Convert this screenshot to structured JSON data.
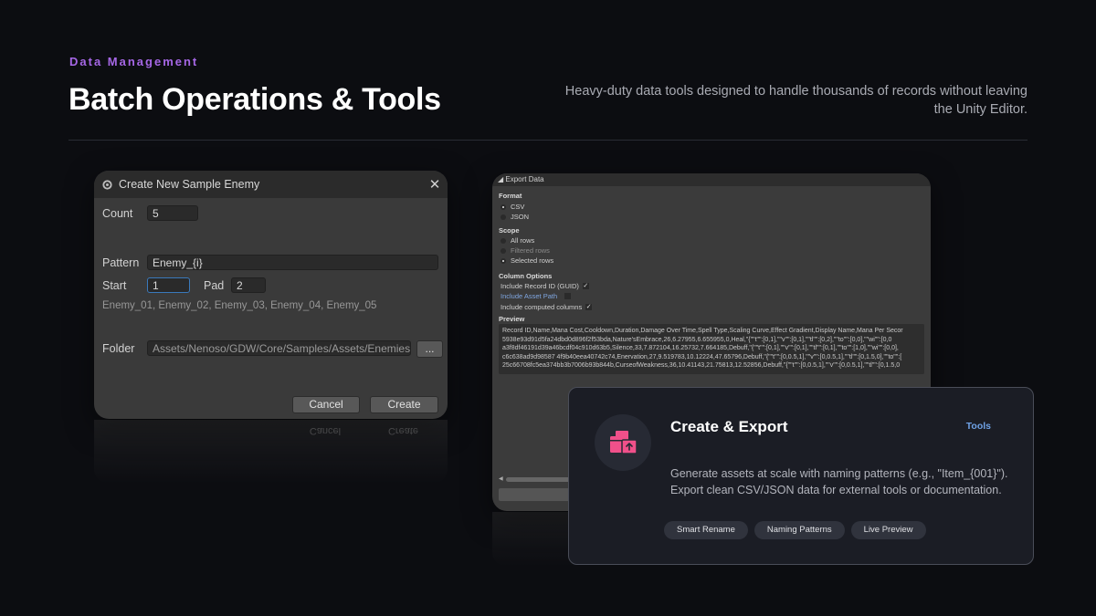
{
  "header": {
    "eyebrow": "Data Management",
    "title": "Batch Operations & Tools",
    "subtitle": "Heavy-duty data tools designed to handle thousands of records without leaving the Unity Editor."
  },
  "create_dialog": {
    "title": "Create New Sample Enemy",
    "count_label": "Count",
    "count_value": "5",
    "pattern_label": "Pattern",
    "pattern_value": "Enemy_{i}",
    "start_label": "Start",
    "start_value": "1",
    "pad_label": "Pad",
    "pad_value": "2",
    "preview_names": "Enemy_01, Enemy_02, Enemy_03, Enemy_04, Enemy_05",
    "folder_label": "Folder",
    "folder_value": "Assets/Nenoso/GDW/Core/Samples/Assets/Enemies",
    "browse_label": "...",
    "cancel_label": "Cancel",
    "create_label": "Create"
  },
  "export_panel": {
    "title": "Export Data",
    "format_label": "Format",
    "format_options": [
      "CSV",
      "JSON"
    ],
    "scope_label": "Scope",
    "scope_options": [
      "All rows",
      "Filtered rows",
      "Selected rows"
    ],
    "column_options_label": "Column Options",
    "column_options": [
      "Include Record ID (GUID)",
      "Include Asset Path",
      "Include computed columns"
    ],
    "preview_label": "Preview",
    "preview_lines": [
      "Record ID,Name,Mana Cost,Cooldown,Duration,Damage Over Time,Spell Type,Scaling Curve,Effect Gradient,Display Name,Mana Per Secor",
      "5938e93d91d5fa24dbd0d896f2f53bda,Nature'sEmbrace,26,6.27955,6.655955,0,Heal,\"{\"\"t\"\":[0,1],\"\"v\"\":[0,1],\"\"tl\"\":[0,2],\"\"to\"\":[0,0],\"\"wi\"\":[0,0",
      "a3f8df46191d39a46bcdf04c910d63b5,Silence,33,7.872104,16.25732,7.664185,Debuff,\"{\"\"t\"\":[0,1],\"\"v\"\":[0,1],\"\"tl\"\":[0,1],\"\"to\"\":[1,0],\"\"wi\"\":[0,0],",
      "c6c638ad9d98587 4f9b40eea40742c74,Enervation,27,9.519783,10.12224,47.65796,Debuff,\"{\"\"t\"\":[0,0.5,1],\"\"v\"\":[0,0.5,1],\"\"tl\"\":[0,1.5,0],\"\"to\"\":[",
      "25c66708fc5ea374bb3b7006b93b844b,CurseofWeakness,36,10.41143,21.75813,12.52856,Debuff,\"{\"\"t\"\":[0,0.5,1],\"\"v\"\":[0,0.5,1],\"\"tl\"\":[0,1.5,0"
    ]
  },
  "feature_card": {
    "title": "Create & Export",
    "tag": "Tools",
    "description": "Generate assets at scale with naming patterns (e.g., \"Item_{001}\"). Export clean CSV/JSON data for external tools or documentation.",
    "chips": [
      "Smart Rename",
      "Naming Patterns",
      "Live Preview"
    ],
    "icon": "boxes-export-icon",
    "icon_color": "#f0508a"
  }
}
